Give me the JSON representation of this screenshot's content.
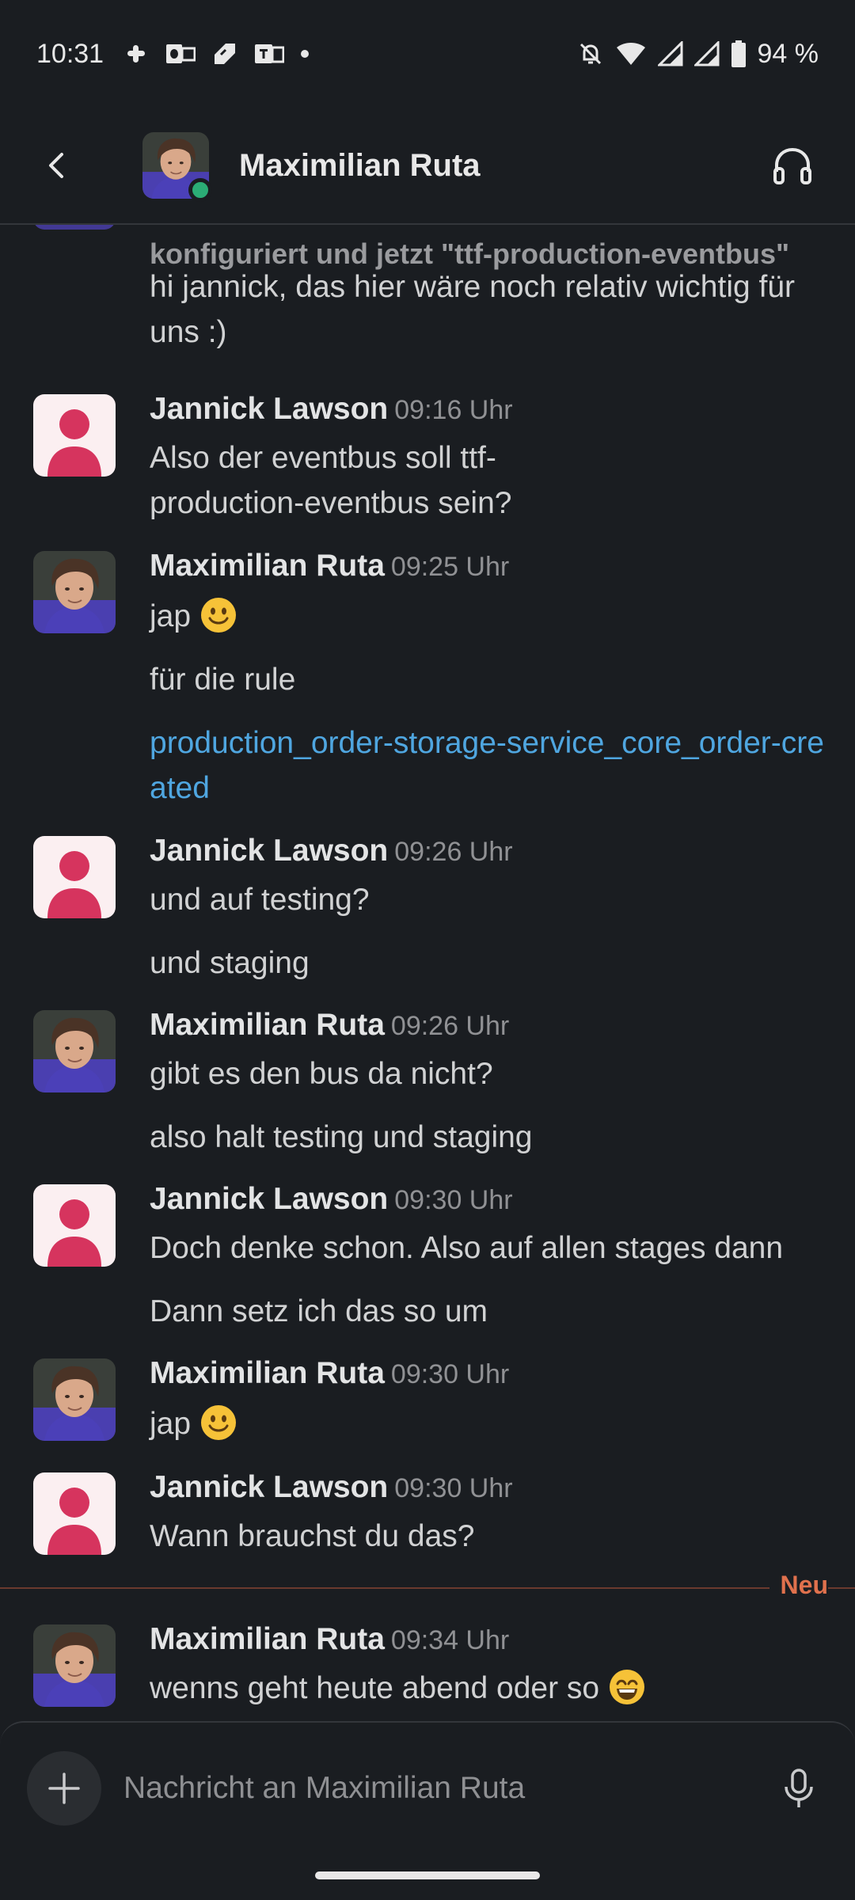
{
  "status_bar": {
    "time": "10:31",
    "battery": "94 %"
  },
  "header": {
    "contact_name": "Maximilian Ruta"
  },
  "messages": {
    "partial_prev_line": "konfiguriert und jetzt \"ttf-production-eventbus\"",
    "partial_prev_body": "hi jannick, das hier wäre noch relativ wichtig für uns :)",
    "groups": [
      {
        "author": "Jannick Lawson",
        "time": "09:16 Uhr",
        "lines": [
          "Also der eventbus soll ttf-production-eventbus sein?"
        ]
      },
      {
        "author": "Maximilian Ruta",
        "time": "09:25 Uhr",
        "lines": [
          "jap",
          "für die rule",
          "production_order-storage-service_core_order-created"
        ]
      },
      {
        "author": "Jannick Lawson",
        "time": "09:26 Uhr",
        "lines": [
          "und auf testing?",
          "und staging"
        ]
      },
      {
        "author": "Maximilian Ruta",
        "time": "09:26 Uhr",
        "lines": [
          "gibt es den bus da nicht?",
          "also halt testing und staging"
        ]
      },
      {
        "author": "Jannick Lawson",
        "time": "09:30 Uhr",
        "lines": [
          "Doch denke schon. Also auf allen stages dann",
          "Dann setz ich das so um"
        ]
      },
      {
        "author": "Maximilian Ruta",
        "time": "09:30 Uhr",
        "lines": [
          "jap"
        ]
      },
      {
        "author": "Jannick Lawson",
        "time": "09:30 Uhr",
        "lines": [
          "Wann brauchst du das?"
        ]
      },
      {
        "author": "Maximilian Ruta",
        "time": "09:34 Uhr",
        "lines": [
          "wenns geht heute abend oder so"
        ]
      }
    ],
    "new_divider_label": "Neu"
  },
  "composer": {
    "placeholder": "Nachricht an Maximilian Ruta"
  }
}
